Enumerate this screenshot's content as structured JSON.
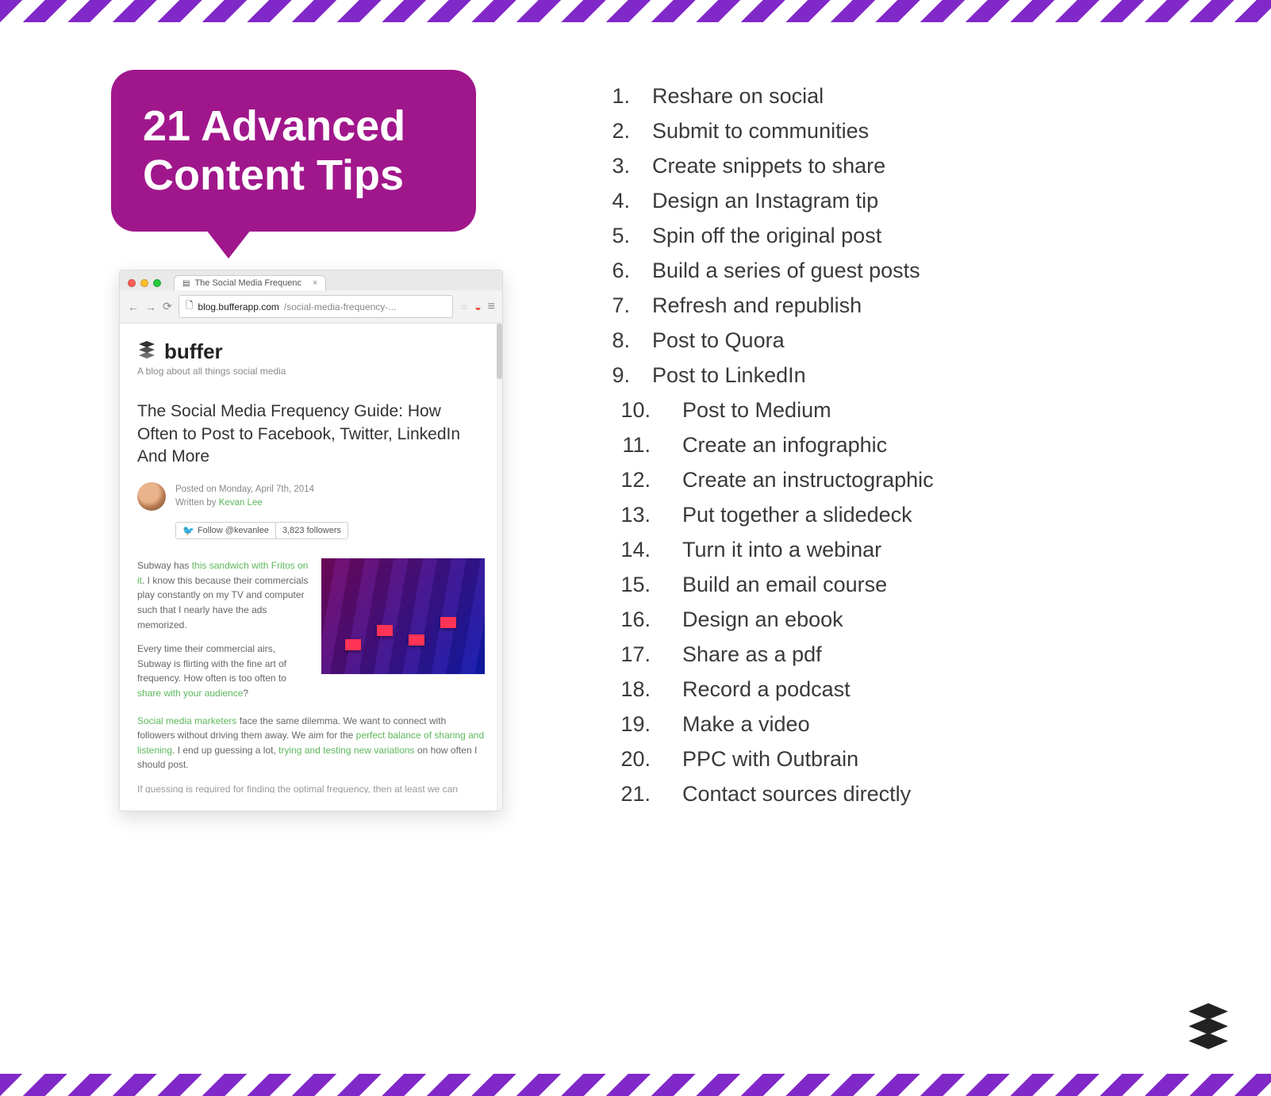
{
  "title_card": "21 Advanced Content Tips",
  "browser": {
    "tab_title": "The Social Media Frequenc",
    "url_host": "blog.bufferapp.com",
    "url_path": "/social-media-frequency-...",
    "brand": "buffer",
    "brand_tagline": "A blog about all things social media",
    "article_title": "The Social Media Frequency Guide: How Often to Post to Facebook, Twitter, LinkedIn And More",
    "posted_on": "Posted on Monday, April 7th, 2014",
    "written_by_prefix": "Written by ",
    "author": "Kevan Lee",
    "follow_label": "Follow @kevanlee",
    "followers": "3,823 followers",
    "p1_pre": "Subway has ",
    "p1_link": "this sandwich with Fritos on it",
    "p1_post": ". I know this because their commercials play constantly on my TV and computer such that I nearly have the ads memorized.",
    "p2_pre": "Every time their commercial airs, Subway is flirting with the fine art of frequency. How often is too often to ",
    "p2_link": "share with your audience",
    "p2_post": "?",
    "p3_link1": "Social media marketers",
    "p3_mid1": " face the same dilemma. We want to connect with followers without driving them away. We aim for the ",
    "p3_link2": "perfect balance of sharing and listening",
    "p3_mid2": ". I end up guessing a lot, ",
    "p3_link3": "trying and testing new variations",
    "p3_post": " on how often I should post.",
    "p4_cutoff": "If guessing is required for finding the optimal frequency, then at least we can"
  },
  "tips": [
    "Reshare on social",
    "Submit to communities",
    "Create snippets to share",
    "Design an Instagram tip",
    "Spin off the original post",
    "Build a series of guest posts",
    "Refresh and republish",
    "Post to Quora",
    "Post to LinkedIn",
    "Post to Medium",
    "Create an infographic",
    "Create an instructographic",
    "Put together a slidedeck",
    "Turn it into a webinar",
    "Build an email course",
    "Design an ebook",
    "Share as a pdf",
    "Record a podcast",
    "Make a video",
    "PPC with Outbrain",
    "Contact sources directly"
  ]
}
